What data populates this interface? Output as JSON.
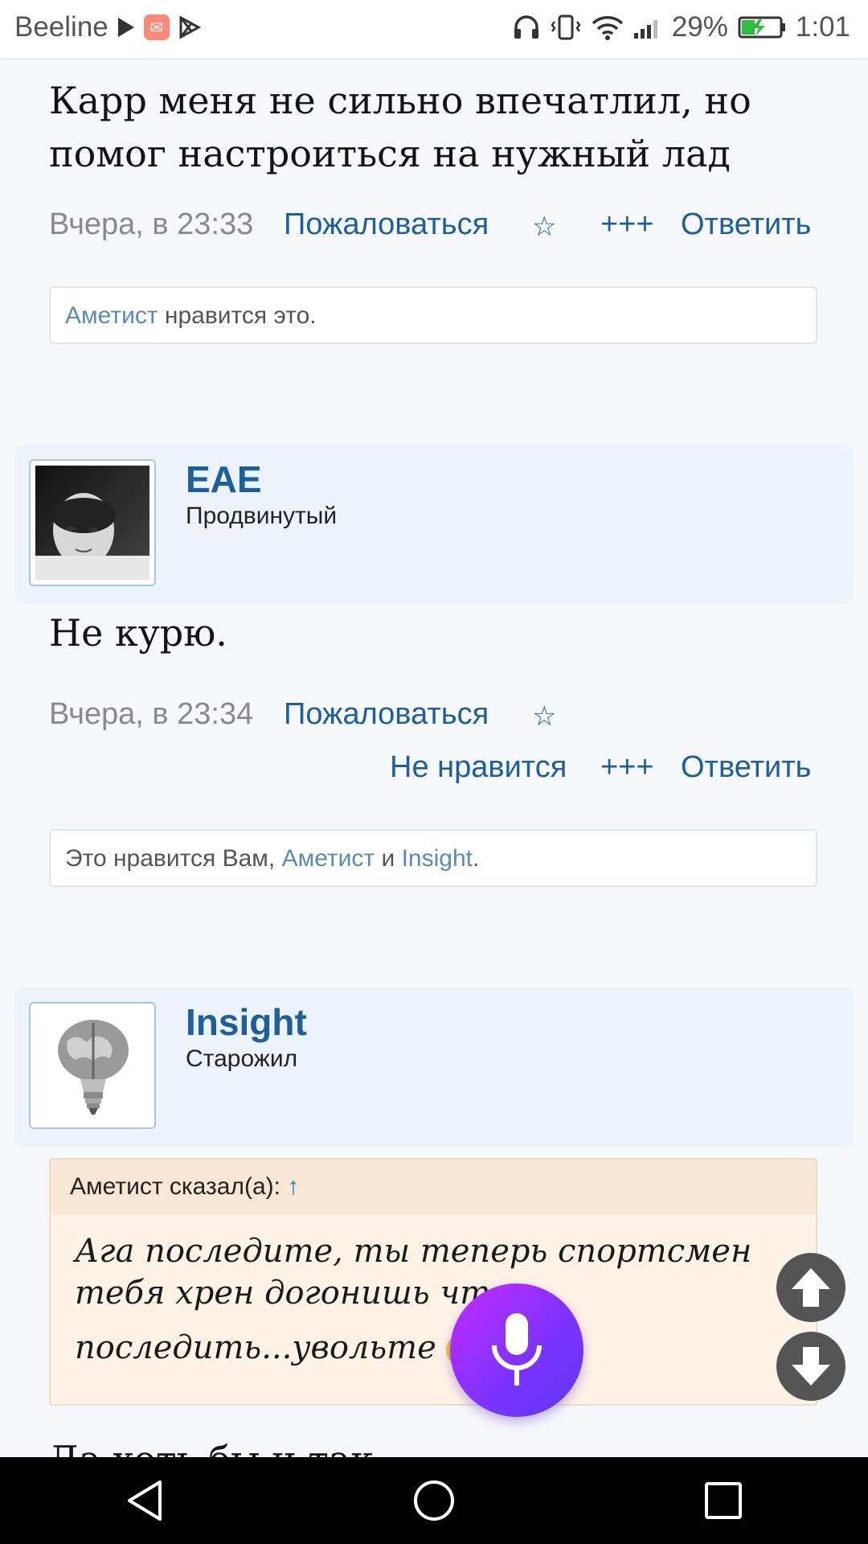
{
  "status_bar": {
    "carrier": "Beeline",
    "battery_percent": "29%",
    "time": "1:01"
  },
  "post1": {
    "text_line1": "Карр меня не сильно впечатлил, но",
    "text_line2": "помог настроиться на нужный лад",
    "time": "Вчера, в 23:33",
    "report": "Пожаловаться",
    "plus": "+++",
    "reply": "Ответить",
    "likes": {
      "name": "Аметист",
      "rest": " нравится это."
    }
  },
  "post2": {
    "author": "EAE",
    "rank": "Продвинутый",
    "text": "Не курю.",
    "time": "Вчера, в 23:34",
    "report": "Пожаловаться",
    "dislike": "Не нравится",
    "plus": "+++",
    "reply": "Ответить",
    "likes": {
      "prefix": "Это нравится Вам, ",
      "name1": "Аметист",
      "and": " и ",
      "name2": "Insight",
      "end": "."
    }
  },
  "post3": {
    "author": "Insight",
    "rank": "Старожил",
    "quote_author": "Аметист сказал(а): ",
    "quote_arrow": "↑",
    "quote_line1": "Ага последите, ты теперь спортсмен",
    "quote_line2": "тебя хрен догонишь что",
    "quote_line3": "последить...увольте",
    "cut_text": "Да хоть бы и так"
  },
  "icons": {
    "play": "play-icon",
    "mail": "mail-icon",
    "store": "play-store-icon",
    "headphones": "headphones-icon",
    "vibrate": "vibrate-icon",
    "wifi": "wifi-icon",
    "signal": "signal-icon",
    "battery": "battery-charging-icon"
  },
  "colors": {
    "link": "#1d5f9c",
    "author_bg": "#edf3fa",
    "quote_bg": "#fdf3e6",
    "mic_gradient_start": "#c32bff",
    "mic_gradient_end": "#5e37f0"
  }
}
